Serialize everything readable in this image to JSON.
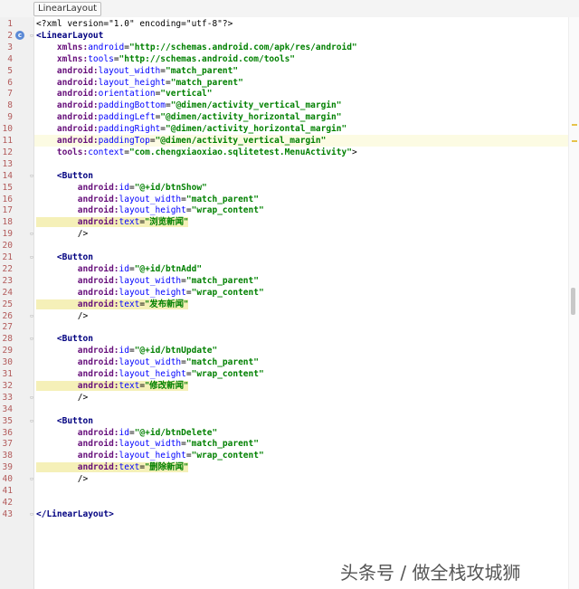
{
  "breadcrumb": "LinearLayout",
  "gutter_icon": "class-icon",
  "lines": [
    {
      "n": "1",
      "parts": [
        [
          "plain",
          "<?xml version=\"1.0\" encoding=\"utf-8\"?>"
        ]
      ]
    },
    {
      "n": "2",
      "parts": [
        [
          "tag",
          "<LinearLayout"
        ]
      ]
    },
    {
      "n": "3",
      "parts": [
        [
          "ns",
          "    xmlns:"
        ],
        [
          "attr",
          "android"
        ],
        [
          "plain",
          "="
        ],
        [
          "val",
          "\"http://schemas.android.com/apk/res/android\""
        ]
      ]
    },
    {
      "n": "4",
      "parts": [
        [
          "ns",
          "    xmlns:"
        ],
        [
          "attr",
          "tools"
        ],
        [
          "plain",
          "="
        ],
        [
          "val",
          "\"http://schemas.android.com/tools\""
        ]
      ]
    },
    {
      "n": "5",
      "parts": [
        [
          "ns",
          "    android:"
        ],
        [
          "attr",
          "layout_width"
        ],
        [
          "plain",
          "="
        ],
        [
          "val",
          "\"match_parent\""
        ]
      ]
    },
    {
      "n": "6",
      "parts": [
        [
          "ns",
          "    android:"
        ],
        [
          "attr",
          "layout_height"
        ],
        [
          "plain",
          "="
        ],
        [
          "val",
          "\"match_parent\""
        ]
      ]
    },
    {
      "n": "7",
      "parts": [
        [
          "ns",
          "    android:"
        ],
        [
          "attr",
          "orientation"
        ],
        [
          "plain",
          "="
        ],
        [
          "val",
          "\"vertical\""
        ]
      ]
    },
    {
      "n": "8",
      "parts": [
        [
          "ns",
          "    android:"
        ],
        [
          "attr",
          "paddingBottom"
        ],
        [
          "plain",
          "="
        ],
        [
          "val",
          "\"@dimen/activity_vertical_margin\""
        ]
      ]
    },
    {
      "n": "9",
      "parts": [
        [
          "ns",
          "    android:"
        ],
        [
          "attr",
          "paddingLeft"
        ],
        [
          "plain",
          "="
        ],
        [
          "val",
          "\"@dimen/activity_horizontal_margin\""
        ]
      ]
    },
    {
      "n": "10",
      "parts": [
        [
          "ns",
          "    android:"
        ],
        [
          "attr",
          "paddingRight"
        ],
        [
          "plain",
          "="
        ],
        [
          "val",
          "\"@dimen/activity_horizontal_margin\""
        ]
      ]
    },
    {
      "n": "11",
      "hl": true,
      "parts": [
        [
          "ns",
          "    android:"
        ],
        [
          "attr",
          "paddingTop"
        ],
        [
          "plain",
          "="
        ],
        [
          "val",
          "\"@dimen/activity_vertical_margin\""
        ]
      ]
    },
    {
      "n": "12",
      "parts": [
        [
          "ns",
          "    tools:"
        ],
        [
          "attr",
          "context"
        ],
        [
          "plain",
          "="
        ],
        [
          "val",
          "\"com.chengxiaoxiao.sqlitetest.MenuActivity\""
        ],
        [
          "plain",
          ">"
        ]
      ]
    },
    {
      "n": "13",
      "parts": []
    },
    {
      "n": "14",
      "parts": [
        [
          "tag",
          "    <Button"
        ]
      ]
    },
    {
      "n": "15",
      "parts": [
        [
          "ns",
          "        android:"
        ],
        [
          "attr",
          "id"
        ],
        [
          "plain",
          "="
        ],
        [
          "val",
          "\"@+id/btnShow\""
        ]
      ]
    },
    {
      "n": "16",
      "parts": [
        [
          "ns",
          "        android:"
        ],
        [
          "attr",
          "layout_width"
        ],
        [
          "plain",
          "="
        ],
        [
          "val",
          "\"match_parent\""
        ]
      ]
    },
    {
      "n": "17",
      "parts": [
        [
          "ns",
          "        android:"
        ],
        [
          "attr",
          "layout_height"
        ],
        [
          "plain",
          "="
        ],
        [
          "val",
          "\"wrap_content\""
        ]
      ]
    },
    {
      "n": "18",
      "parts": [
        [
          "ns mark",
          "        android:"
        ],
        [
          "attr mark",
          "text"
        ],
        [
          "plain mark",
          "="
        ],
        [
          "zh mark",
          "\"浏览新闻\""
        ]
      ]
    },
    {
      "n": "19",
      "parts": [
        [
          "plain",
          "        />"
        ]
      ]
    },
    {
      "n": "20",
      "parts": []
    },
    {
      "n": "21",
      "parts": [
        [
          "tag",
          "    <Button"
        ]
      ]
    },
    {
      "n": "22",
      "parts": [
        [
          "ns",
          "        android:"
        ],
        [
          "attr",
          "id"
        ],
        [
          "plain",
          "="
        ],
        [
          "val",
          "\"@+id/btnAdd\""
        ]
      ]
    },
    {
      "n": "23",
      "parts": [
        [
          "ns",
          "        android:"
        ],
        [
          "attr",
          "layout_width"
        ],
        [
          "plain",
          "="
        ],
        [
          "val",
          "\"match_parent\""
        ]
      ]
    },
    {
      "n": "24",
      "parts": [
        [
          "ns",
          "        android:"
        ],
        [
          "attr",
          "layout_height"
        ],
        [
          "plain",
          "="
        ],
        [
          "val",
          "\"wrap_content\""
        ]
      ]
    },
    {
      "n": "25",
      "parts": [
        [
          "ns mark",
          "        android:"
        ],
        [
          "attr mark",
          "text"
        ],
        [
          "plain mark",
          "="
        ],
        [
          "zh mark",
          "\"发布新闻\""
        ]
      ]
    },
    {
      "n": "26",
      "parts": [
        [
          "plain",
          "        />"
        ]
      ]
    },
    {
      "n": "27",
      "parts": []
    },
    {
      "n": "28",
      "parts": [
        [
          "tag",
          "    <Button"
        ]
      ]
    },
    {
      "n": "29",
      "parts": [
        [
          "ns",
          "        android:"
        ],
        [
          "attr",
          "id"
        ],
        [
          "plain",
          "="
        ],
        [
          "val",
          "\"@+id/btnUpdate\""
        ]
      ]
    },
    {
      "n": "30",
      "parts": [
        [
          "ns",
          "        android:"
        ],
        [
          "attr",
          "layout_width"
        ],
        [
          "plain",
          "="
        ],
        [
          "val",
          "\"match_parent\""
        ]
      ]
    },
    {
      "n": "31",
      "parts": [
        [
          "ns",
          "        android:"
        ],
        [
          "attr",
          "layout_height"
        ],
        [
          "plain",
          "="
        ],
        [
          "val",
          "\"wrap_content\""
        ]
      ]
    },
    {
      "n": "32",
      "parts": [
        [
          "ns mark",
          "        android:"
        ],
        [
          "attr mark",
          "text"
        ],
        [
          "plain mark",
          "="
        ],
        [
          "zh mark",
          "\"修改新闻\""
        ]
      ]
    },
    {
      "n": "33",
      "parts": [
        [
          "plain",
          "        />"
        ]
      ]
    },
    {
      "n": "34",
      "parts": []
    },
    {
      "n": "35",
      "parts": [
        [
          "tag",
          "    <Button"
        ]
      ]
    },
    {
      "n": "36",
      "parts": [
        [
          "ns",
          "        android:"
        ],
        [
          "attr",
          "id"
        ],
        [
          "plain",
          "="
        ],
        [
          "val",
          "\"@+id/btnDelete\""
        ]
      ]
    },
    {
      "n": "37",
      "parts": [
        [
          "ns",
          "        android:"
        ],
        [
          "attr",
          "layout_width"
        ],
        [
          "plain",
          "="
        ],
        [
          "val",
          "\"match_parent\""
        ]
      ]
    },
    {
      "n": "38",
      "parts": [
        [
          "ns",
          "        android:"
        ],
        [
          "attr",
          "layout_height"
        ],
        [
          "plain",
          "="
        ],
        [
          "val",
          "\"wrap_content\""
        ]
      ]
    },
    {
      "n": "39",
      "parts": [
        [
          "ns mark",
          "        android:"
        ],
        [
          "attr mark",
          "text"
        ],
        [
          "plain mark",
          "="
        ],
        [
          "zh mark",
          "\"删除新闻\""
        ]
      ]
    },
    {
      "n": "40",
      "parts": [
        [
          "plain",
          "        />"
        ]
      ]
    },
    {
      "n": "41",
      "parts": []
    },
    {
      "n": "42",
      "parts": []
    },
    {
      "n": "43",
      "parts": [
        [
          "tag",
          "</LinearLayout>"
        ]
      ]
    }
  ],
  "watermark": "头条号 / 做全栈攻城狮",
  "colors": {
    "line_number": "#b25a5a",
    "tag": "#000080",
    "attr": "#0000ff",
    "value": "#008000",
    "highlight": "#fcfbe3"
  }
}
